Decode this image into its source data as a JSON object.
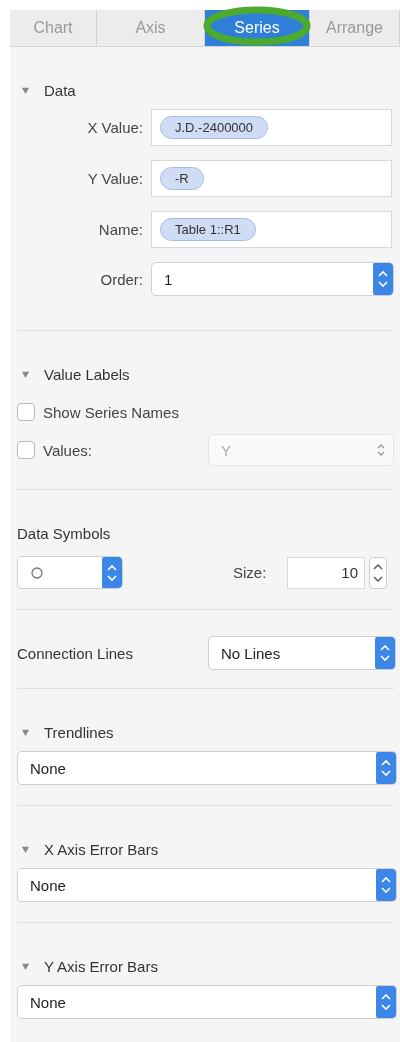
{
  "tabs": [
    {
      "label": "Chart",
      "selected": false
    },
    {
      "label": "Axis",
      "selected": false
    },
    {
      "label": "Series",
      "selected": true
    },
    {
      "label": "Arrange",
      "selected": false
    }
  ],
  "data": {
    "title": "Data",
    "expanded": true,
    "fields": [
      {
        "label": "X Value:",
        "token": "J.D.-2400000"
      },
      {
        "label": "Y Value:",
        "token": "-R"
      },
      {
        "label": "Name:",
        "token": "Table 1::R1"
      }
    ],
    "order": {
      "label": "Order:",
      "value": "1"
    }
  },
  "value_labels": {
    "title": "Value Labels",
    "expanded": true,
    "show_series_names": {
      "label": "Show Series Names",
      "checked": false
    },
    "values": {
      "label": "Values:",
      "checked": false,
      "value": "Y",
      "disabled": true
    }
  },
  "data_symbols": {
    "title": "Data Symbols",
    "size_label": "Size:",
    "size": "10"
  },
  "connection_lines": {
    "label": "Connection Lines",
    "value": "No Lines"
  },
  "dropdown_sections": [
    {
      "title": "Trendlines",
      "expanded": true,
      "value": "None"
    },
    {
      "title": "X Axis Error Bars",
      "expanded": true,
      "value": "None"
    },
    {
      "title": "Y Axis Error Bars",
      "expanded": true,
      "value": "None"
    }
  ]
}
